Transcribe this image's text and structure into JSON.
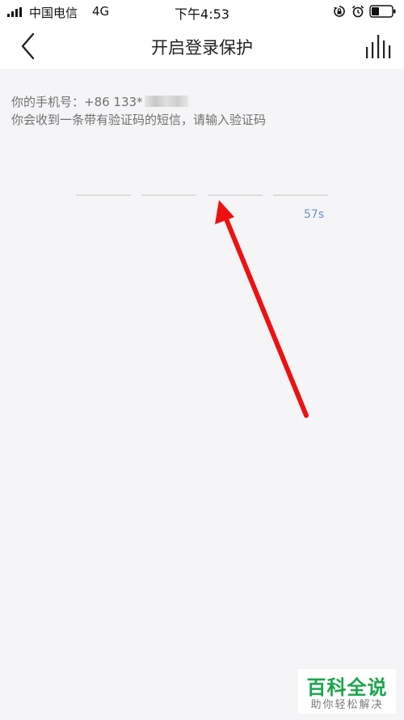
{
  "status_bar": {
    "carrier": "中国电信",
    "network": "4G",
    "time": "下午4:53"
  },
  "nav": {
    "title": "开启登录保护"
  },
  "info": {
    "phone_label": "你的手机号：+86 133*",
    "hint": "你会收到一条带有验证码的短信，请输入验证码"
  },
  "code_input": {
    "slot_count": 4,
    "countdown": "57s"
  },
  "colors": {
    "accent": "#6f92c8",
    "arrow": "#ee1111",
    "watermark": "#1aa64a"
  },
  "watermark": {
    "title": "百科全说",
    "subtitle": "助你轻松解决"
  }
}
